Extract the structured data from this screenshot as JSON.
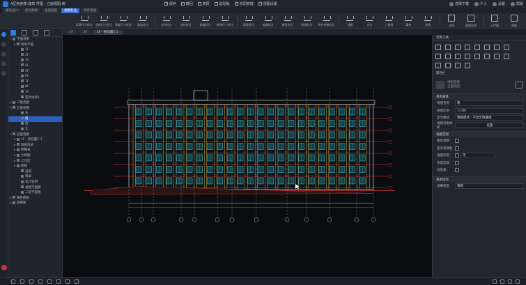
{
  "titlebar": {
    "title": "A区宿舍楼-建筑-导图 - 立面视图:南",
    "quick": [
      "保存",
      "撤回",
      "复原",
      "剪贴板",
      "协同管理",
      "视图设置"
    ],
    "right": [
      "选择下载",
      "个人",
      "设置",
      "帮助"
    ]
  },
  "tabs": [
    "建筑设计",
    "结构建模",
    "出图设置",
    "视图标注",
    "构件管理"
  ],
  "ribbon": {
    "groups": [
      {
        "items": [
          "标高尺寸标注",
          "坐标尺寸标注",
          "角度尺寸标注",
          "弧度标注"
        ]
      },
      {
        "items": [
          "对齐标注",
          "线性标注",
          "角度标注",
          "单侧尺寸标注"
        ]
      },
      {
        "items": [
          "高程标注",
          "坡度标注",
          "轴号标注",
          "构造标注",
          "构件参数标注"
        ]
      },
      {
        "items": [
          "详图",
          "文字",
          "三维线",
          "填充",
          "云线"
        ]
      },
      {
        "items": [
          "比例",
          "缩放比例"
        ]
      },
      {
        "items": [
          "上传图",
          "视图"
        ]
      }
    ]
  },
  "tree": {
    "nodes": [
      {
        "label": "平面视图",
        "level": 0,
        "expanded": true
      },
      {
        "label": "场地平面",
        "level": 1
      },
      {
        "label": "1F",
        "level": 2
      },
      {
        "label": "2F",
        "level": 2
      },
      {
        "label": "3F",
        "level": 2
      },
      {
        "label": "4F",
        "level": 2
      },
      {
        "label": "5F",
        "level": 2
      },
      {
        "label": "6F",
        "level": 2
      },
      {
        "label": "7F",
        "level": 2
      },
      {
        "label": "8F",
        "level": 2
      },
      {
        "label": "1F",
        "level": 2
      },
      {
        "label": "室外地坪1",
        "level": 2
      },
      {
        "label": "三维视图",
        "level": 0
      },
      {
        "label": "立面视图",
        "level": 0,
        "expanded": true
      },
      {
        "label": "东",
        "level": 2
      },
      {
        "label": "南",
        "level": 2,
        "selected": true
      },
      {
        "label": "西",
        "level": 2
      },
      {
        "label": "北",
        "level": 2
      },
      {
        "label": "剖面视图",
        "level": 0,
        "expanded": true
      },
      {
        "label": "1F - 剖切面1 1",
        "level": 1
      },
      {
        "label": "图纸目录",
        "level": 1
      },
      {
        "label": "明细表",
        "level": 1
      },
      {
        "label": "大样图",
        "level": 1
      },
      {
        "label": "工作区",
        "level": 1
      },
      {
        "label": "图纸",
        "level": 1,
        "expanded": true
      },
      {
        "label": "封皮",
        "level": 2
      },
      {
        "label": "目录",
        "level": 2
      },
      {
        "label": "设计说明",
        "level": 2
      },
      {
        "label": "总图平面图",
        "level": 2
      },
      {
        "label": "二层平面图",
        "level": 2
      },
      {
        "label": "属性模板",
        "level": 0
      },
      {
        "label": "族模板",
        "level": 0
      }
    ]
  },
  "doc_tabs": [
    "2F",
    "3F",
    "1F - 剖切面1 1"
  ],
  "props": {
    "header": "常用工具",
    "tool_icons": [
      "move-icon",
      "copy-icon",
      "rotate-icon",
      "mirror-icon",
      "array-icon",
      "align-icon",
      "offset-icon",
      "scale-icon",
      "trim-icon",
      "split-icon",
      "extend-icon",
      "join-icon",
      "pin-icon",
      "unpin-icon",
      "group-icon",
      "ungroup-icon",
      "delete-icon",
      "hide-icon",
      "isolate-icon",
      "match-icon"
    ],
    "mini_title": "属性栏",
    "type_lines": [
      "视图选择",
      "立面视图"
    ],
    "sections": [
      {
        "title": "基本属性",
        "rows": [
          {
            "k": "视图名称",
            "v": "南",
            "kind": "text"
          },
          {
            "k": "视图比例",
            "v": "1:100",
            "kind": "select"
          },
          {
            "k": "显示模式",
            "v": "线框模式 - 不显示隐藏线",
            "kind": "select"
          },
          {
            "k": "视图对象样式",
            "v": "设置",
            "kind": "button"
          }
        ]
      },
      {
        "title": "视图范围",
        "rows": [
          {
            "k": "裁剪视图",
            "kind": "check"
          },
          {
            "k": "显示剪裁框",
            "kind": "check"
          },
          {
            "k": "视图深度",
            "v": "无",
            "kind": "select2"
          },
          {
            "k": "深度剪裁",
            "kind": "check"
          },
          {
            "k": "远剪裁",
            "kind": "check"
          }
        ]
      },
      {
        "title": "基本操作",
        "rows": [
          {
            "k": "详细程度",
            "v": "粗略",
            "kind": "select"
          }
        ]
      }
    ]
  },
  "colors": {
    "accent": "#2f7de1",
    "canvas": "#0b0c0f",
    "red": "#d23a3a",
    "green": "#39c463",
    "cyan": "#3cc7d2"
  }
}
